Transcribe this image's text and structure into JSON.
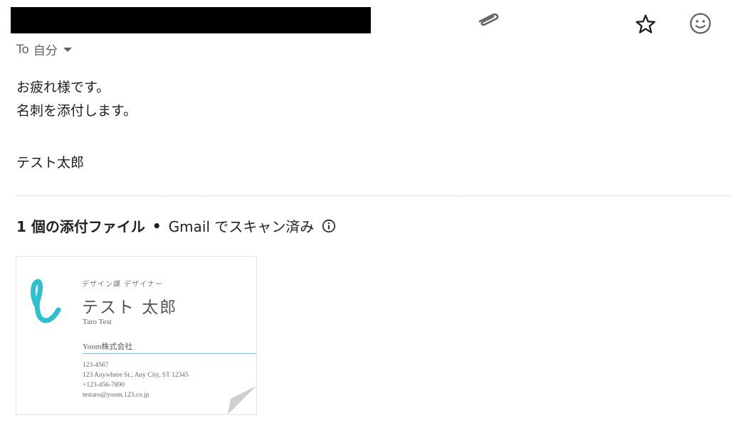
{
  "header": {
    "recipient_prefix": "To",
    "recipient_name": "自分",
    "icons": [
      "paperclip-icon",
      "star-icon",
      "emoji-icon",
      "chevron-down-icon"
    ]
  },
  "body": {
    "lines": [
      "お疲れ様です。",
      "名刺を添付します。"
    ],
    "signature": "テスト太郎"
  },
  "attachments": {
    "count_label": "1 個の添付ファイル",
    "separator": "•",
    "scan_label": "Gmail でスキャン済み",
    "card": {
      "department": "デザイン課 デザイナー",
      "name": "テスト 太郎",
      "name_romaji": "Taro Test",
      "company": "Yoom株式会社",
      "phone": "123-4567",
      "address": "123 Anywhere St., Any City, ST 12345",
      "phone_intl": "+123-456-7890",
      "email": "testaro@yoom.123.co.jp",
      "logo_color": "#2bc1cf",
      "accent_rule_color": "#6ccfd2"
    }
  }
}
